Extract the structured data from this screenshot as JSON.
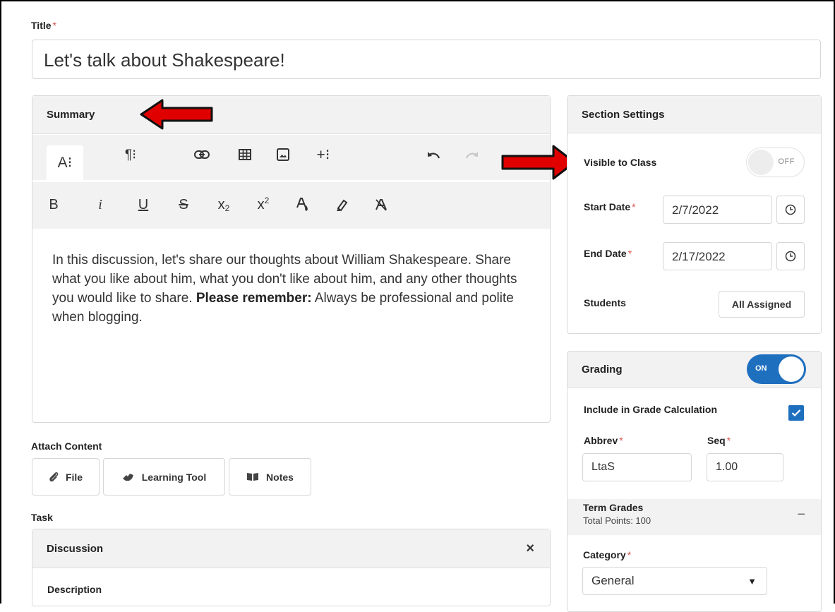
{
  "title": {
    "label": "Title",
    "required": "*",
    "value": "Let's talk about Shakespeare!"
  },
  "summary": {
    "header": "Summary",
    "toolbar_row1": {
      "font_style": "A⁝",
      "paragraph": "¶⁝",
      "insert_more": "+⁝"
    },
    "toolbar_row2": {
      "bold": "B",
      "italic": "i",
      "underline": "U",
      "strike": "S",
      "subscript": "x",
      "subscript_small": "2",
      "superscript": "x",
      "superscript_small": "2"
    },
    "body_text": "In this discussion, let's share our thoughts about William Shakespeare.  Share what you like about him, what you don't like about him, and any other thoughts you would like to share.",
    "body_bold": "Please remember:",
    "body_tail": "Always be professional and polite when blogging."
  },
  "attach": {
    "label": "Attach Content",
    "buttons": {
      "file": "File",
      "learning_tool": "Learning Tool",
      "notes": "Notes"
    }
  },
  "task": {
    "label": "Task",
    "header": "Discussion",
    "close": "×",
    "description_label": "Description"
  },
  "section_settings": {
    "header": "Section Settings",
    "visible_label": "Visible to Class",
    "visible_toggle": "OFF",
    "start_label": "Start Date",
    "start_value": "2/7/2022",
    "end_label": "End Date",
    "end_value": "2/17/2022",
    "required": "*",
    "students_label": "Students",
    "students_button": "All Assigned"
  },
  "grading": {
    "header": "Grading",
    "toggle": "ON",
    "include_label": "Include in Grade Calculation",
    "include_checked": true,
    "abbrev_label": "Abbrev",
    "abbrev_value": "LtaS",
    "seq_label": "Seq",
    "seq_value": "1.00",
    "required": "*",
    "term_title": "Term Grades",
    "term_points": "Total Points: 100",
    "term_collapse": "−",
    "category_label": "Category",
    "category_value": "General"
  },
  "colors": {
    "accent": "#1f6fbf",
    "required": "#d9534f",
    "arrow": "#e00000",
    "panel_header": "#f2f2f2"
  },
  "icons": [
    "link-icon",
    "table-icon",
    "image-icon",
    "undo-icon",
    "redo-icon",
    "text-color-icon",
    "highlight-icon",
    "clear-format-icon",
    "paperclip-icon",
    "puzzle-icon",
    "book-icon",
    "clock-icon",
    "check-icon",
    "close-icon",
    "caret-down-icon"
  ]
}
